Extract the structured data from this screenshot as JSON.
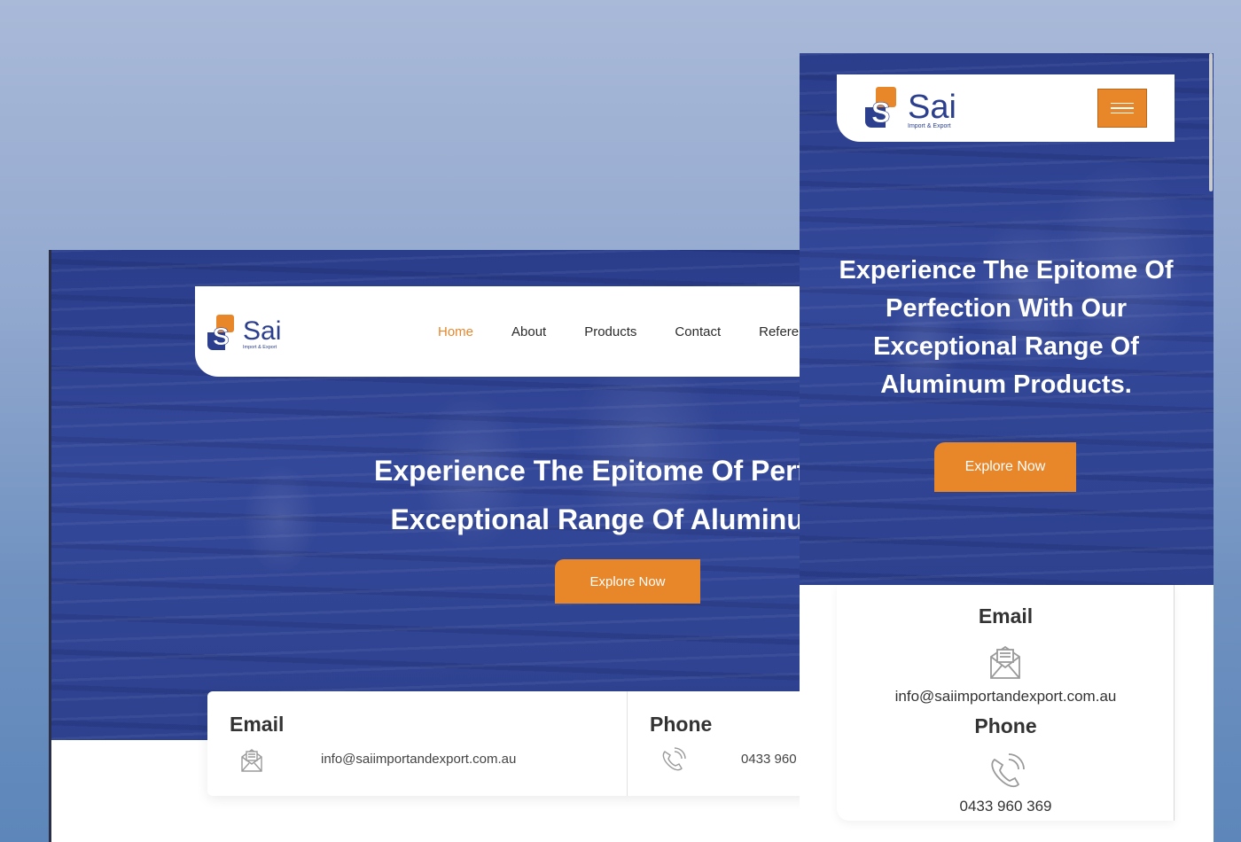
{
  "brand": {
    "name": "Sai",
    "tagline": "Import & Export",
    "colors": {
      "navy": "#2b3f8e",
      "orange": "#e8862a"
    }
  },
  "desktop": {
    "nav": {
      "items": [
        "Home",
        "About",
        "Products",
        "Contact",
        "Refere"
      ],
      "active": "Home"
    },
    "hero": {
      "line1": "Experience The Epitome Of Perfectio",
      "line2": "Exceptional Range Of Aluminum P",
      "cta": "Explore Now"
    },
    "contact": {
      "email_title": "Email",
      "email_value": "info@saiimportandexport.com.au",
      "email_icon": "envelope-icon",
      "phone_title": "Phone",
      "phone_value": "0433 960",
      "phone_icon": "phone-icon"
    }
  },
  "mobile": {
    "menu_icon": "hamburger-icon",
    "hero": {
      "line1": "Experience The Epitome Of",
      "line2": "Perfection With Our",
      "line3": "Exceptional Range Of",
      "line4": "Aluminum Products.",
      "cta": "Explore Now"
    },
    "contact": {
      "email_title": "Email",
      "email_value": "info@saiimportandexport.com.au",
      "email_icon": "envelope-icon",
      "phone_title": "Phone",
      "phone_value": "0433 960 369",
      "phone_icon": "phone-icon"
    }
  }
}
